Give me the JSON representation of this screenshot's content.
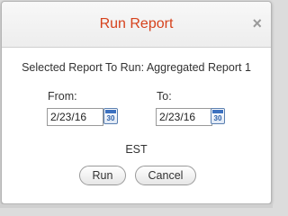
{
  "dialog": {
    "title": "Run Report",
    "close_glyph": "×",
    "selected_text": "Selected Report To Run: Aggregated Report 1",
    "from_label": "From:",
    "from_value": "2/23/16",
    "to_label": "To:",
    "to_value": "2/23/16",
    "calendar_glyph": "30",
    "timezone": "EST",
    "run_label": "Run",
    "cancel_label": "Cancel"
  },
  "colors": {
    "title": "#d6421c",
    "calendar": "#2a5ea8"
  },
  "icons": [
    "close-icon",
    "calendar-icon"
  ]
}
